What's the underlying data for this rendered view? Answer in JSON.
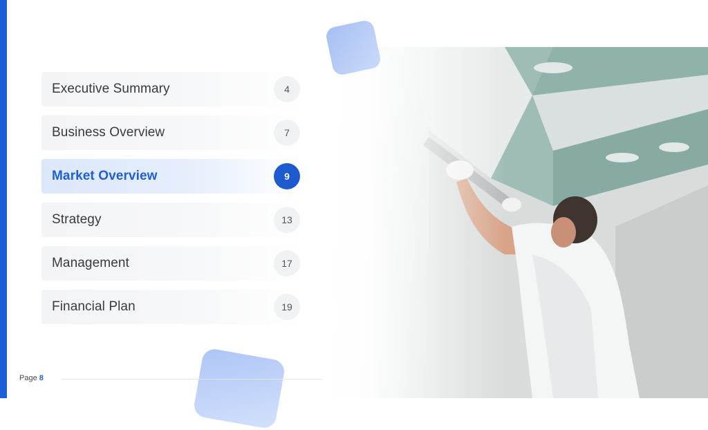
{
  "toc": {
    "items": [
      {
        "label": "Executive Summary",
        "page": "4"
      },
      {
        "label": "Business Overview",
        "page": "7"
      },
      {
        "label": "Market Overview",
        "page": "9"
      },
      {
        "label": "Strategy",
        "page": "13"
      },
      {
        "label": "Management",
        "page": "17"
      },
      {
        "label": "Financial Plan",
        "page": "19"
      }
    ],
    "active_index": 2
  },
  "footer": {
    "page_label": "Page",
    "page_number": "8"
  },
  "colors": {
    "accent": "#1f5fd6",
    "deco": "#a9c2f5"
  }
}
